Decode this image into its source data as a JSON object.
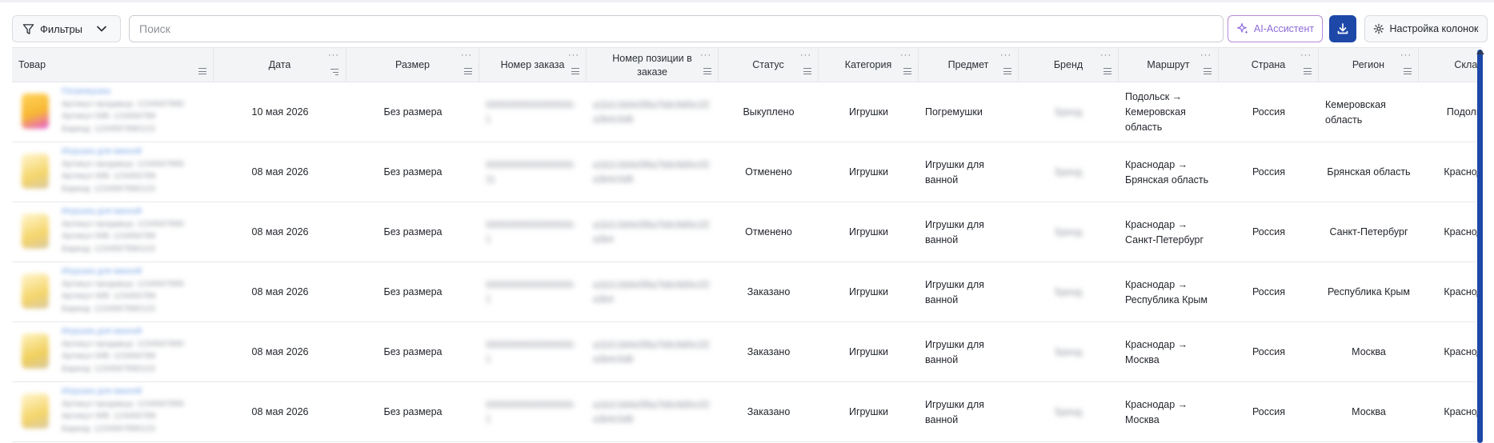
{
  "toolbar": {
    "filters_label": "Фильтры",
    "search_placeholder": "Поиск",
    "ai_label": "AI-Ассистент",
    "columns_label": "Настройка колонок"
  },
  "columns": [
    {
      "key": "tovar",
      "label": "Товар"
    },
    {
      "key": "data",
      "label": "Дата"
    },
    {
      "key": "razmer",
      "label": "Размер"
    },
    {
      "key": "nomer_zakaza",
      "label": "Номер заказа"
    },
    {
      "key": "nomer_pozicii",
      "label": "Номер позиции в заказе"
    },
    {
      "key": "status",
      "label": "Статус"
    },
    {
      "key": "kategoriya",
      "label": "Категория"
    },
    {
      "key": "predmet",
      "label": "Предмет"
    },
    {
      "key": "brend",
      "label": "Бренд"
    },
    {
      "key": "marshrut",
      "label": "Маршрут"
    },
    {
      "key": "strana",
      "label": "Страна"
    },
    {
      "key": "region",
      "label": "Регион"
    },
    {
      "key": "sklad",
      "label": "Склад"
    }
  ],
  "rows": [
    {
      "product_link": "Погремушка",
      "product_lines": [
        "Артикул продавца: 1234567890",
        "Артикул WB: 123456789",
        "Баркод: 1234567890123"
      ],
      "date": "10 мая 2026",
      "size": "Без размера",
      "order": "00000000000000000-1",
      "position": "a1b2c3d4e5f6a7b8c9d0e1f2a3b4c5d6",
      "status": "Выкуплено",
      "category": "Игрушки",
      "subject": "Погремушки",
      "brand": "Бренд",
      "route": "Подольск → Кемеровская область",
      "country": "Россия",
      "region": "Кемеровская область",
      "warehouse": "Подольск"
    },
    {
      "product_link": "Игрушка для ванной",
      "product_lines": [
        "Артикул продавца: 1234567890",
        "Артикул WB: 123456789",
        "Баркод: 1234567890123"
      ],
      "date": "08 мая 2026",
      "size": "Без размера",
      "order": "00000000000000000-11",
      "position": "a1b2c3d4e5f6a7b8c9d0e1f2a3b4c5d6",
      "status": "Отменено",
      "category": "Игрушки",
      "subject": "Игрушки для ванной",
      "brand": "Бренд",
      "route": "Краснодар → Брянская область",
      "country": "Россия",
      "region": "Брянская область",
      "warehouse": "Краснодар"
    },
    {
      "product_link": "Игрушка для ванной",
      "product_lines": [
        "Артикул продавца: 1234567890",
        "Артикул WB: 123456789",
        "Баркод: 1234567890123"
      ],
      "date": "08 мая 2026",
      "size": "Без размера",
      "order": "00000000000000000-1",
      "position": "a1b2c3d4e5f6a7b8c9d0e1f2a3b4",
      "status": "Отменено",
      "category": "Игрушки",
      "subject": "Игрушки для ванной",
      "brand": "Бренд",
      "route": "Краснодар → Санкт-Петербург",
      "country": "Россия",
      "region": "Санкт-Петербург",
      "warehouse": "Краснодар"
    },
    {
      "product_link": "Игрушка для ванной",
      "product_lines": [
        "Артикул продавца: 1234567890",
        "Артикул WB: 123456789",
        "Баркод: 1234567890123"
      ],
      "date": "08 мая 2026",
      "size": "Без размера",
      "order": "00000000000000000-1",
      "position": "a1b2c3d4e5f6a7b8c9d0e1f2a3b4",
      "status": "Заказано",
      "category": "Игрушки",
      "subject": "Игрушки для ванной",
      "brand": "Бренд",
      "route": "Краснодар → Республика Крым",
      "country": "Россия",
      "region": "Республика Крым",
      "warehouse": "Краснодар"
    },
    {
      "product_link": "Игрушка для ванной",
      "product_lines": [
        "Артикул продавца: 1234567890",
        "Артикул WB: 123456789",
        "Баркод: 1234567890123"
      ],
      "date": "08 мая 2026",
      "size": "Без размера",
      "order": "00000000000000000-1",
      "position": "a1b2c3d4e5f6a7b8c9d0e1f2a3b4c5d6",
      "status": "Заказано",
      "category": "Игрушки",
      "subject": "Игрушки для ванной",
      "brand": "Бренд",
      "route": "Краснодар → Москва",
      "country": "Россия",
      "region": "Москва",
      "warehouse": "Краснодар"
    },
    {
      "product_link": "Игрушка для ванной",
      "product_lines": [
        "Артикул продавца: 1234567890",
        "Артикул WB: 123456789",
        "Баркод: 1234567890123"
      ],
      "date": "08 мая 2026",
      "size": "Без размера",
      "order": "00000000000000000-1",
      "position": "a1b2c3d4e5f6a7b8c9d0e1f2a3b4c5d6",
      "status": "Заказано",
      "category": "Игрушки",
      "subject": "Игрушки для ванной",
      "brand": "Бренд",
      "route": "Краснодар → Москва",
      "country": "Россия",
      "region": "Москва",
      "warehouse": "Краснодар"
    }
  ],
  "colors": {
    "accent": "#1d48a8",
    "ai_purple": "#8d6ad8",
    "header_bg": "#f3f4f6",
    "link": "#6a9be3"
  },
  "icons": {
    "filters": "funnel-icon",
    "dropdown": "chevron-down-icon",
    "ai": "sparkle-icon",
    "download": "download-icon",
    "settings": "gear-icon"
  }
}
